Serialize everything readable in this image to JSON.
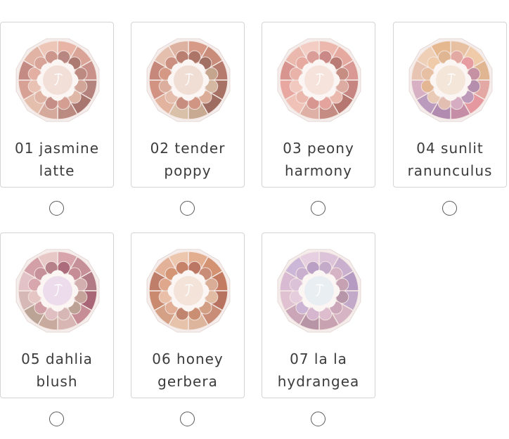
{
  "products": [
    {
      "line1": "01 jasmine",
      "line2": "latte",
      "colors": [
        "#e7b4a6",
        "#d9a397",
        "#c99189",
        "#b5837e",
        "#a9766f",
        "#bb8a80",
        "#d5aa9d",
        "#e5bfae",
        "#d8a196",
        "#c48b84",
        "#e0b3a4",
        "#edc6b8"
      ],
      "center": "#f2dfd8"
    },
    {
      "line1": "02 tender",
      "line2": "poppy",
      "colors": [
        "#d79a86",
        "#c98b7a",
        "#b67b6c",
        "#a87165",
        "#9e6c61",
        "#c8aa92",
        "#d9c0a8",
        "#e2b49f",
        "#d39382",
        "#c6887a",
        "#e5bfae",
        "#deb2a0"
      ],
      "center": "#f0ddd4"
    },
    {
      "line1": "03 peony",
      "line2": "harmony",
      "colors": [
        "#ecb7ad",
        "#e6a9a0",
        "#d99893",
        "#c78582",
        "#b5776f",
        "#c48c82",
        "#dfb0a5",
        "#f0c2b7",
        "#e8a7a1",
        "#d8948f",
        "#eab8ac",
        "#f3cdc3"
      ],
      "center": "#f5e3dc"
    },
    {
      "line1": "04 sunlit",
      "line2": "ranunculus",
      "colors": [
        "#e7c0a2",
        "#f0cba9",
        "#e0b592",
        "#e3a8a4",
        "#e698a0",
        "#c58ea6",
        "#b18cb0",
        "#ba9bbd",
        "#d7b0c4",
        "#e8c4b3",
        "#efd0b6",
        "#e6b88f"
      ],
      "center": "#f4e6d9"
    },
    {
      "line1": "05 dahlia",
      "line2": "blush",
      "colors": [
        "#d7a5ab",
        "#c69098",
        "#b27a84",
        "#a86676",
        "#c78d96",
        "#d7b6b4",
        "#c9aa9f",
        "#bba495",
        "#d6b8b7",
        "#e2c2c6",
        "#d4a0a8",
        "#e8c8c7"
      ],
      "center": "#ecdcec"
    },
    {
      "line1": "06 honey",
      "line2": "gerbera",
      "colors": [
        "#e3ad90",
        "#d39272",
        "#c37c62",
        "#b87260",
        "#c88c77",
        "#ddb49c",
        "#e6c3aa",
        "#d4a186",
        "#c98a6f",
        "#be7e69",
        "#e2b198",
        "#edc6ae"
      ],
      "center": "#f3e3d8"
    },
    {
      "line1": "07 la la",
      "line2": "hydrangea",
      "colors": [
        "#dcc3d9",
        "#c9b0cf",
        "#b59bc2",
        "#c3a9c9",
        "#d7b4c4",
        "#c8a2b0",
        "#b795a6",
        "#caa6b8",
        "#e0c1d1",
        "#d9bad3",
        "#cdb7d8",
        "#e6cfe0"
      ],
      "center": "#e8eef2"
    }
  ]
}
